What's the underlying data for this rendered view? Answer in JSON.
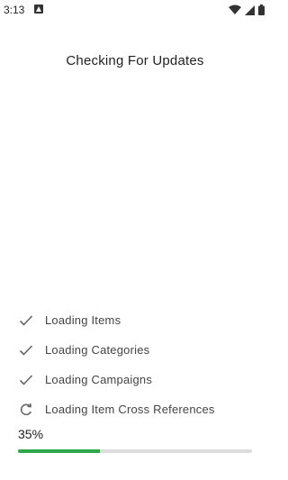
{
  "status_bar": {
    "time": "3:13",
    "icons": [
      "notification-a-icon",
      "wifi-icon",
      "signal-icon",
      "battery-icon"
    ]
  },
  "title": "Checking For Updates",
  "tasks": [
    {
      "label": "Loading Items",
      "state": "done",
      "icon": "check-icon"
    },
    {
      "label": "Loading Categories",
      "state": "done",
      "icon": "check-icon"
    },
    {
      "label": "Loading Campaigns",
      "state": "done",
      "icon": "check-icon"
    },
    {
      "label": "Loading Item Cross References",
      "state": "in-progress",
      "icon": "refresh-icon"
    }
  ],
  "progress": {
    "label": "35%",
    "value": 0.35
  },
  "colors": {
    "progress_fill": "#2da84a",
    "progress_track": "#dddddd",
    "icon": "#666666"
  }
}
